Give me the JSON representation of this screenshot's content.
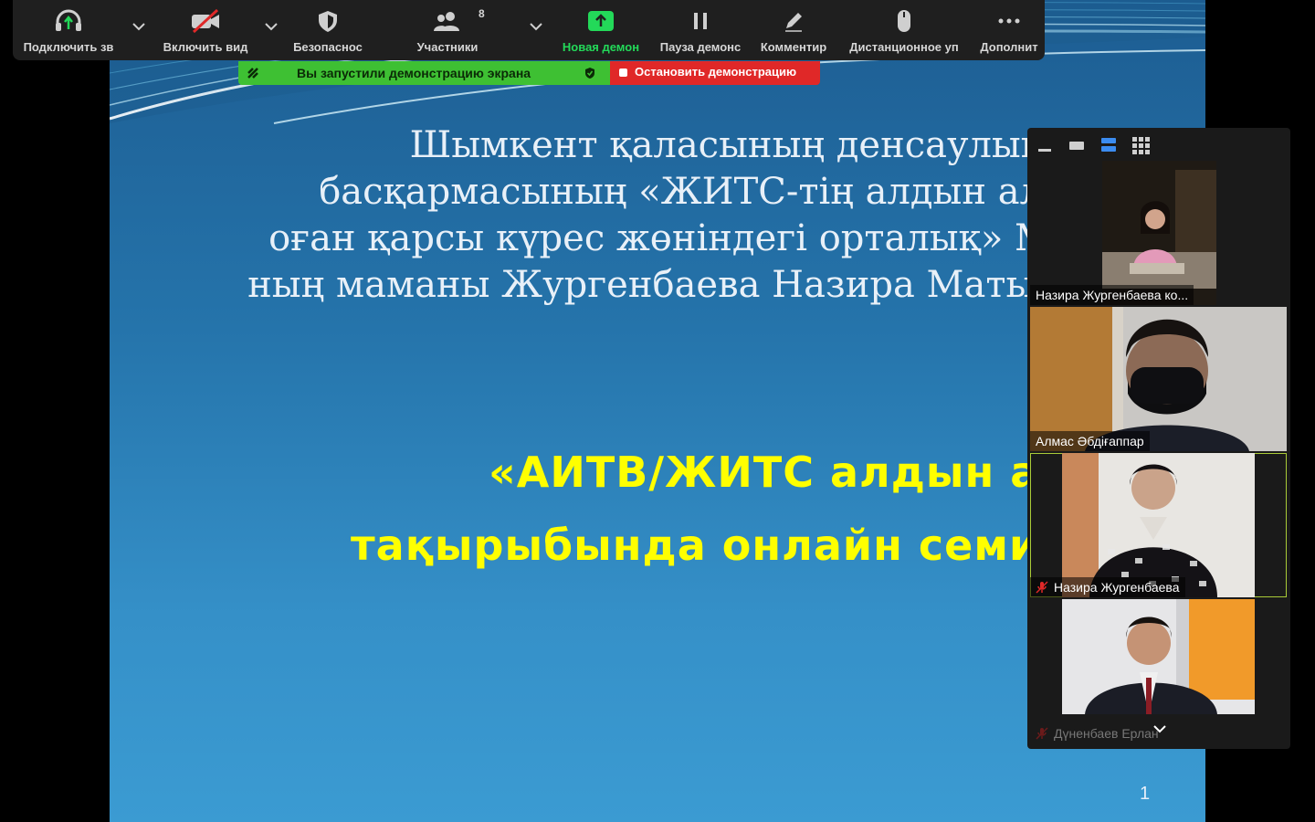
{
  "toolbar": {
    "audio_label": "Подключить зв",
    "video_label": "Включить вид",
    "security_label": "Безопаснос",
    "participants_label": "Участники",
    "participants_count": "8",
    "new_share_label": "Новая демон",
    "pause_share_label": "Пауза демонс",
    "annotate_label": "Комментир",
    "remote_label": "Дистанционное уп",
    "more_label": "Дополнит",
    "accent_color": "#23d959"
  },
  "share_banner": {
    "status_text": "Вы запустили демонстрацию экрана",
    "stop_label": "Остановить демонстрацию"
  },
  "slide": {
    "title_lines": [
      "Шымкент қаласының денсаулық",
      "басқармасының  «ЖИТС-тің алдын ал",
      "оған қарсы күрес жөніндегі орталық» М",
      "ның  маманы Жургенбаева Назира Матып"
    ],
    "subtitle_lines": [
      "«АИТВ/ЖИТС алдын ал",
      "тақырыбында онлайн семин"
    ],
    "page_number": "1",
    "subtitle_color": "#ffff00"
  },
  "video_panel": {
    "participants": [
      {
        "name": "Назира Жургенбаева ко...",
        "muted": false
      },
      {
        "name": "Алмас Әбдіғаппар",
        "muted": false
      },
      {
        "name": "Назира Жургенбаева",
        "muted": true
      },
      {
        "name": "Дүненбаев Ерлан",
        "muted": true
      }
    ]
  }
}
